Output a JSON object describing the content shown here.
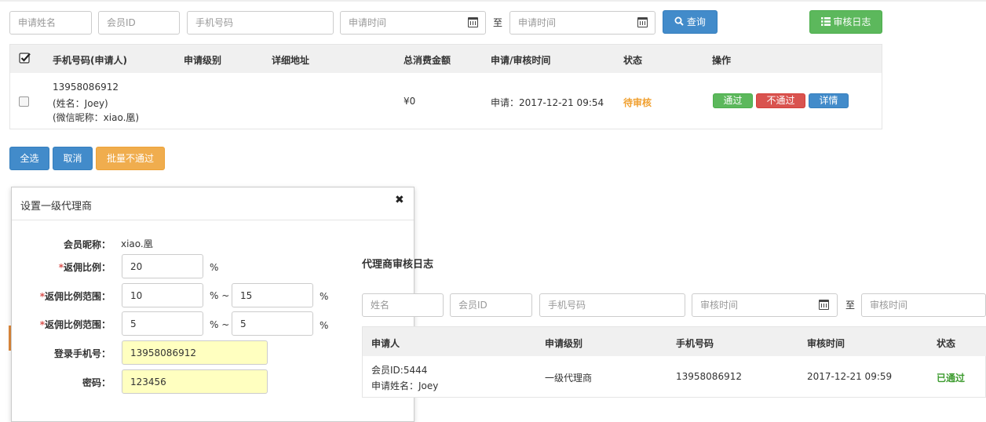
{
  "filters": {
    "name_placeholder": "申请姓名",
    "member_id_placeholder": "会员ID",
    "phone_placeholder": "手机号码",
    "date_start_placeholder": "申请时间",
    "date_end_placeholder": "申请时间",
    "to_label": "至",
    "search_label": "查询",
    "audit_log_label": "审核日志"
  },
  "table": {
    "headers": [
      "手机号码(申请人)",
      "申请级别",
      "详细地址",
      "总消费金额",
      "申请/审核时间",
      "状态",
      "操作"
    ],
    "rows": [
      {
        "phone": "13958086912",
        "name": "(姓名：Joey)",
        "wechat": "(微信昵称：xiao.凰)",
        "level": "",
        "address": "",
        "total": "¥0",
        "time": "申请：2017-12-21 09:54",
        "status": "待审核",
        "actions": {
          "approve": "通过",
          "reject": "不通过",
          "detail": "详情"
        }
      }
    ]
  },
  "bulk": {
    "select_all": "全选",
    "cancel": "取消",
    "batch_reject": "批量不通过"
  },
  "modal": {
    "title": "设置一级代理商",
    "close": "✖",
    "nickname_label": "会员昵称：",
    "nickname_value": "xiao.凰",
    "rebate_label": "返佣比例：",
    "rebate_value": "20",
    "percent": "%",
    "range_label": "返佣比例范围：",
    "range1_min": "10",
    "range1_max": "15",
    "range2_min": "5",
    "range2_max": "5",
    "percent_tilde": "% ~",
    "login_phone_label": "登录手机号：",
    "login_phone_value": "13958086912",
    "password_label": "密码：",
    "password_value": "123456"
  },
  "audit": {
    "title": "代理商审核日志",
    "name_placeholder": "姓名",
    "member_id_placeholder": "会员ID",
    "phone_placeholder": "手机号码",
    "time_start_placeholder": "审核时间",
    "time_end_placeholder": "审核时间",
    "to_label": "至",
    "headers": [
      "申请人",
      "申请级别",
      "手机号码",
      "审核时间",
      "状态"
    ],
    "rows": [
      {
        "member_id": "会员ID:5444",
        "applicant_name": "申请姓名：Joey",
        "level": "一级代理商",
        "phone": "13958086912",
        "time": "2017-12-21 09:59",
        "status": "已通过"
      }
    ]
  },
  "colors": {
    "primary": "#428bca",
    "success": "#5cb85c",
    "danger": "#d9534f",
    "warning": "#f0ad4e",
    "pending_text": "#f0a030",
    "passed_text": "#3c9b2e",
    "required": "#d9534f"
  },
  "icons": {
    "calendar": "calendar-icon",
    "search": "search-icon",
    "list": "list-icon",
    "close": "close-icon",
    "checkbox": "checkbox"
  }
}
